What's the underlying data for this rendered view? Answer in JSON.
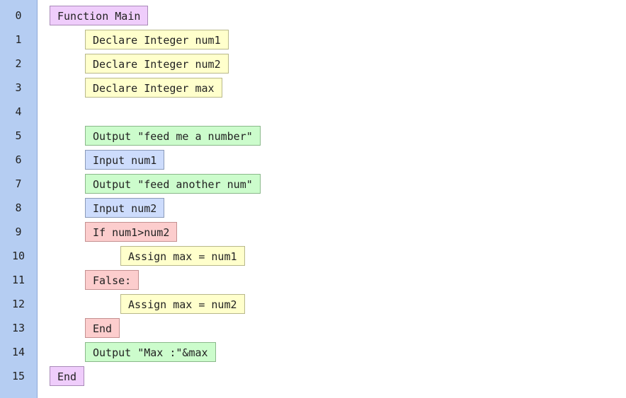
{
  "colors": {
    "gutter": "#b5cdf2",
    "function": "#efcdfb",
    "declare": "#ffffcc",
    "output": "#ccfccc",
    "input": "#cddcfc",
    "if": "#fccdcd",
    "assign": "#ffffcc"
  },
  "lines": [
    {
      "number": "0",
      "indent": 0,
      "type": "function",
      "text": "Function Main"
    },
    {
      "number": "1",
      "indent": 1,
      "type": "declare",
      "text": "Declare Integer num1"
    },
    {
      "number": "2",
      "indent": 1,
      "type": "declare",
      "text": "Declare Integer num2"
    },
    {
      "number": "3",
      "indent": 1,
      "type": "declare",
      "text": "Declare Integer max"
    },
    {
      "number": "4",
      "indent": 1,
      "type": "blank",
      "text": ""
    },
    {
      "number": "5",
      "indent": 1,
      "type": "output",
      "text": "Output \"feed me a number\""
    },
    {
      "number": "6",
      "indent": 1,
      "type": "input",
      "text": "Input num1"
    },
    {
      "number": "7",
      "indent": 1,
      "type": "output",
      "text": "Output \"feed another num\""
    },
    {
      "number": "8",
      "indent": 1,
      "type": "input",
      "text": "Input num2"
    },
    {
      "number": "9",
      "indent": 1,
      "type": "if",
      "text": "If num1>num2"
    },
    {
      "number": "10",
      "indent": 2,
      "type": "assign",
      "text": "Assign max = num1"
    },
    {
      "number": "11",
      "indent": 1,
      "type": "if",
      "text": "False:"
    },
    {
      "number": "12",
      "indent": 2,
      "type": "assign",
      "text": "Assign max = num2"
    },
    {
      "number": "13",
      "indent": 1,
      "type": "if",
      "text": "End"
    },
    {
      "number": "14",
      "indent": 1,
      "type": "output",
      "text": "Output \"Max :\"&max"
    },
    {
      "number": "15",
      "indent": 0,
      "type": "function",
      "text": "End"
    }
  ]
}
